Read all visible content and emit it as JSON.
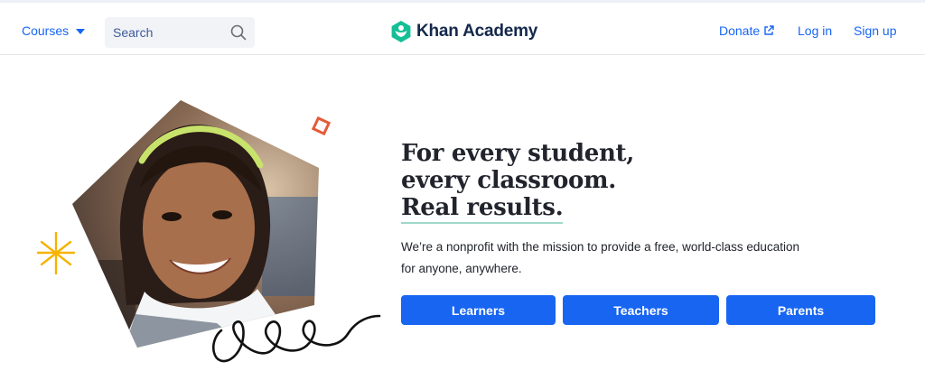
{
  "nav": {
    "courses_label": "Courses",
    "search_placeholder": "Search",
    "brand": "Khan Academy",
    "donate_label": "Donate",
    "login_label": "Log in",
    "signup_label": "Sign up"
  },
  "hero": {
    "headline_line1": "For every student,",
    "headline_line2": "every classroom.",
    "headline_line3": "Real results.",
    "mission": "We’re a nonprofit with the mission to provide a free, world-class education for anyone, anywhere.",
    "buttons": [
      {
        "label": "Learners"
      },
      {
        "label": "Teachers"
      },
      {
        "label": "Parents"
      }
    ]
  },
  "icons": {
    "courses": "chevron-down-icon",
    "search": "search-icon",
    "logo": "khan-hexagon-logo",
    "donate": "external-link-icon",
    "decor": [
      "sparkle-icon",
      "diamond-outline-icon",
      "squiggle-icon"
    ]
  },
  "colors": {
    "primary": "#1865f2",
    "brand_text": "#14284b",
    "logo_green": "#14bf96",
    "underline": "#9fd8c9",
    "sparkle": "#f5b300",
    "diamond": "#e35b3a"
  }
}
